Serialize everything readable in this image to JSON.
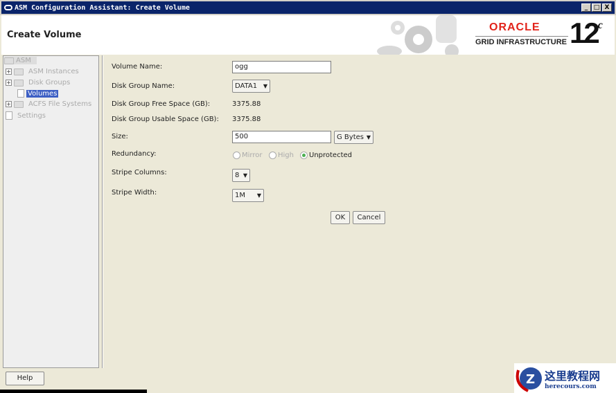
{
  "window": {
    "title": "ASM Configuration Assistant: Create Volume",
    "minimize": "_",
    "maximize": "□",
    "close": "X"
  },
  "header": {
    "title": "Create Volume",
    "brand": "ORACLE",
    "product": "GRID INFRASTRUCTURE",
    "version": "12",
    "version_suffix": "c"
  },
  "tree": {
    "root": "ASM",
    "items": [
      {
        "label": "ASM Instances"
      },
      {
        "label": "Disk Groups"
      },
      {
        "label": "Volumes"
      },
      {
        "label": "ACFS File Systems"
      },
      {
        "label": "Settings"
      }
    ]
  },
  "form": {
    "volume_name_label": "Volume Name:",
    "volume_name": "ogg",
    "disk_group_label": "Disk Group Name:",
    "disk_group": "DATA1",
    "free_label": "Disk Group Free Space (GB):",
    "free": "3375.88",
    "usable_label": "Disk Group Usable Space (GB):",
    "usable": "3375.88",
    "size_label": "Size:",
    "size": "500",
    "size_unit": "G Bytes",
    "redundancy_label": "Redundancy:",
    "redundancy_options": [
      "Mirror",
      "High",
      "Unprotected"
    ],
    "redundancy_selected": "Unprotected",
    "stripe_columns_label": "Stripe Columns:",
    "stripe_columns": "8",
    "stripe_width_label": "Stripe Width:",
    "stripe_width": "1M",
    "ok": "OK",
    "cancel": "Cancel"
  },
  "footer": {
    "help": "Help"
  },
  "watermark": {
    "text": "这里教程网",
    "site": "herecours.com"
  }
}
